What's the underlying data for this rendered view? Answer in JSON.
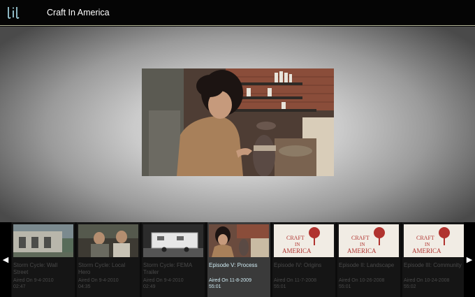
{
  "app": {
    "title": "Craft In America",
    "logo_text": "lil",
    "accent": "#b9bb9c"
  },
  "player": {
    "now_playing": "Episode V: Process"
  },
  "episodes": [
    {
      "title": "Storm Cycle: Wall Street",
      "aired": "Aired On 9-4-2010",
      "duration": "02:47",
      "thumb": "house"
    },
    {
      "title": "Storm Cycle: Local Hero",
      "aired": "Aired On 9-4-2010",
      "duration": "04:35",
      "thumb": "people"
    },
    {
      "title": "Storm Cycle: FEMA Trailer",
      "aired": "Aired On 9-4-2010",
      "duration": "02:49",
      "thumb": "trailer"
    },
    {
      "title": "Episode V: Process",
      "aired": "Aired On 11-8-2009",
      "duration": "55:01",
      "thumb": "pottery",
      "active": true
    },
    {
      "title": "Episode IV: Origins",
      "aired": "Aired On 11-7-2008",
      "duration": "55:01",
      "thumb": "logo"
    },
    {
      "title": "Episode II: Landscape",
      "aired": "Aired On 10-26-2008",
      "duration": "55:01",
      "thumb": "logo"
    },
    {
      "title": "Episode III: Community",
      "aired": "Aired On 10-24-2008",
      "duration": "55:02",
      "thumb": "logo"
    }
  ],
  "thumb_logo_text": [
    "CRAFT",
    "IN",
    "AMERICA"
  ],
  "nav": {
    "prev_icon": "triangle-left-icon",
    "next_icon": "triangle-right-icon"
  }
}
